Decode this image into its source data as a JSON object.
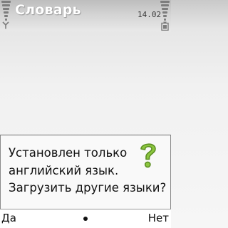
{
  "status_bar": {
    "app_title": "Словарь",
    "clock": "14.02",
    "signal_level": 1.0,
    "battery_level": 1.0
  },
  "dialog": {
    "lines": [
      "Установлен только",
      "английский язык.",
      "Загрузить другие языки?"
    ],
    "icon": "question-mark-icon"
  },
  "softkeys": {
    "left_label": "Да",
    "right_label": "Нет",
    "middle": "select-dot"
  },
  "colors": {
    "question_icon": "#8cc63f",
    "title_text": "#ffffff",
    "indicator_bars": "#7d7d7d"
  }
}
